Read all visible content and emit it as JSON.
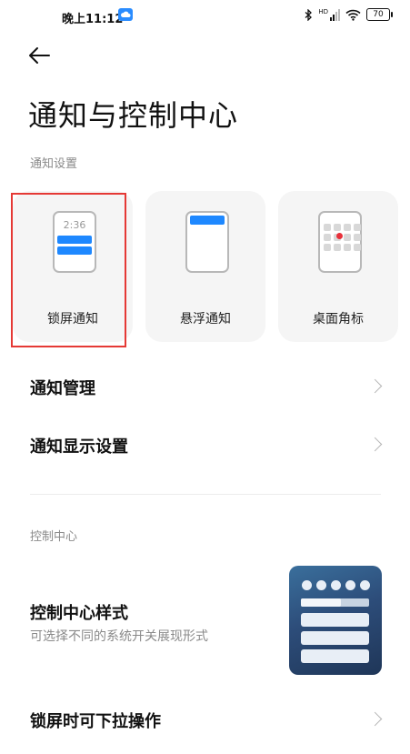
{
  "status_bar": {
    "time": "晚上11:12",
    "battery": "70",
    "network": "HD"
  },
  "header": {
    "back_icon": "back-arrow-icon",
    "title": "通知与控制中心"
  },
  "notifications": {
    "section_label": "通知设置",
    "cards": [
      {
        "label": "锁屏通知",
        "preview_time": "2:36",
        "icon": "lockscreen-phone-icon"
      },
      {
        "label": "悬浮通知",
        "icon": "floating-phone-icon"
      },
      {
        "label": "桌面角标",
        "icon": "badge-phone-icon"
      }
    ],
    "rows": [
      {
        "label": "通知管理"
      },
      {
        "label": "通知显示设置"
      }
    ]
  },
  "control_center": {
    "section_label": "控制中心",
    "style_title": "控制中心样式",
    "style_subtitle": "可选择不同的系统开关展现形式",
    "pull_down_label": "锁屏时可下拉操作"
  },
  "colors": {
    "accent": "#1e88ff",
    "highlight_border": "#e53935",
    "badge_dot": "#e8303a"
  }
}
